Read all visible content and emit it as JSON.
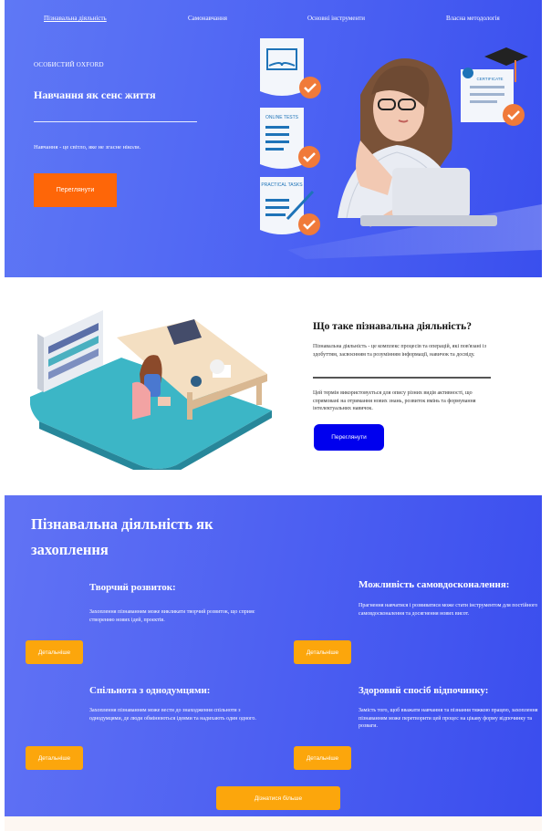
{
  "nav": {
    "items": [
      "Пізнавальна діяльність",
      "Самонавчання",
      "Основні інструменти",
      "Власна методологія"
    ]
  },
  "hero": {
    "kicker": "ОСОБИСТИЙ OXFORD",
    "title": "Навчання як сенс життя",
    "subtitle": "Навчання - це світло, яке не згасне ніколи.",
    "button": "Переглянути",
    "art": {
      "card_online": "ONLINE TESTS",
      "card_practical": "PRACTICAL TASKS",
      "certificate": "CERTIFICATE"
    }
  },
  "about": {
    "title": "Що таке пізнавальна діяльність?",
    "p1": "Пізнавальна діяльність - це комплекс процесів та операцій, які пов'язані із здобуттям, засвоєнням та розумінням інформації, навичок та досвіду.",
    "p2": "Цей термін використовується для опису різних видів активності, що спрямовані на отримання нових знань, розвиток вмінь та формування інтелектуальних навичок.",
    "button": "Переглянути"
  },
  "passion": {
    "title": "Пізнавальна діяльність як захоплення",
    "cards": [
      {
        "title": "Творчий розвиток:",
        "text": "Захоплення пізнаванням може викликати творчий розвиток, що сприяє створенню нових ідей, проєктів.",
        "button": "Детальніше"
      },
      {
        "title": "Можливість самовдосконалення:",
        "text": "Прагнення навчатися і розвиватися може стати інструментом для постійного самовдосконалення та досягнення нових висот.",
        "button": "Детальніше"
      },
      {
        "title": "Спільнота з однодумцями:",
        "text": "Захоплення пізнаванням може вести до знаходження спільноти з однодумцями, де люди обмінюються ідеями та надихають один одного.",
        "button": "Детальніше"
      },
      {
        "title": "Здоровий спосіб відпочинку:",
        "text": "Замість того, щоб вважати навчання та пізнання тяжкою працею, захоплення пізнаванням може перетворити цей процес на цікаву форму відпочинку та розваги.",
        "button": "Детальніше"
      }
    ],
    "learn_more": "Дізнатися більше"
  },
  "colors": {
    "hero_bg": "#4c62f3",
    "orange_button": "#fe6608",
    "blue_button": "#0000ee",
    "amber_button": "#fca60c",
    "check_badge": "#f07a3a"
  }
}
